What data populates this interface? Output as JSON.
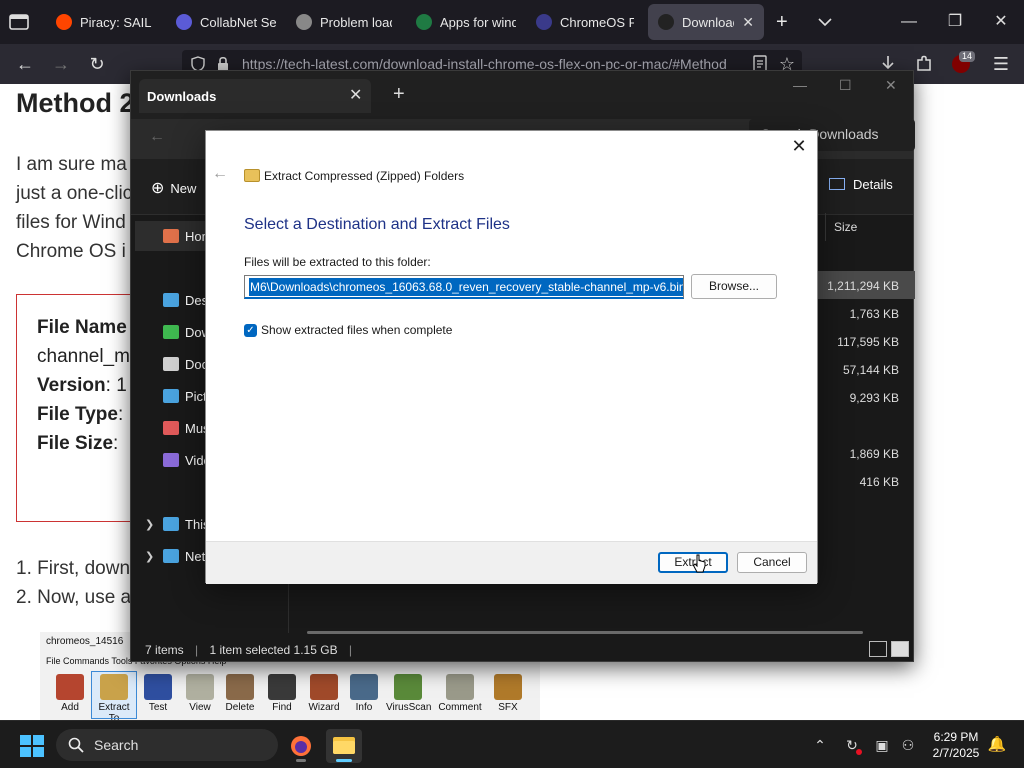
{
  "browser": {
    "tabs": [
      {
        "label": "Piracy: SAIL THE",
        "icon": "reddit-icon",
        "color": "#ff4500"
      },
      {
        "label": "CollabNet Sea",
        "icon": "search-icon",
        "color": "#5b5bd6"
      },
      {
        "label": "Problem loadi",
        "icon": "info-icon",
        "color": "#888888"
      },
      {
        "label": "Apps for winde",
        "icon": "excel-icon",
        "color": "#1f7a43"
      },
      {
        "label": "ChromeOS Fle",
        "icon": "chromeos-icon",
        "color": "#3a3a8a"
      },
      {
        "label": "Download a",
        "icon": "techlatest-icon",
        "color": "#222222"
      }
    ],
    "active_tab_index": 5,
    "url": "https://tech-latest.com/download-install-chrome-os-flex-on-pc-or-mac/#Method",
    "extension_badge": "14"
  },
  "article": {
    "heading": "Method 2",
    "paragraph": [
      "I am sure ma",
      "just a one-clic",
      "files for Wind",
      "Chrome OS i"
    ],
    "info": [
      {
        "key": "File Name",
        "value": ""
      },
      {
        "key": "",
        "value": "channel_m"
      },
      {
        "key": "Version",
        "value": ": 1"
      },
      {
        "key": "File Type",
        "value": ":"
      },
      {
        "key": "File Size",
        "value": ":"
      }
    ],
    "steps": [
      "1. First, down",
      "2. Now, use a"
    ]
  },
  "winrar": {
    "title": "chromeos_14516",
    "menu": "File   Commands   Tools   Favorites   Options   Help",
    "tools": [
      {
        "label": "Add",
        "icon": "add-archive-icon",
        "color": "#b5452f"
      },
      {
        "label": "Extract To",
        "icon": "extract-to-icon",
        "color": "#c9a24a",
        "selected": true
      },
      {
        "label": "Test",
        "icon": "test-icon",
        "color": "#2f4fa0"
      },
      {
        "label": "View",
        "icon": "view-icon",
        "color": "#b0b0a0"
      },
      {
        "label": "Delete",
        "icon": "delete-icon",
        "color": "#8a6a4a"
      },
      {
        "label": "Find",
        "icon": "find-icon",
        "color": "#3a3a3a"
      },
      {
        "label": "Wizard",
        "icon": "wizard-icon",
        "color": "#a04a2a"
      },
      {
        "label": "Info",
        "icon": "info-icon",
        "color": "#4a6a8a"
      },
      {
        "label": "VirusScan",
        "icon": "virusscan-icon",
        "color": "#5a8a3a"
      },
      {
        "label": "Comment",
        "icon": "comment-icon",
        "color": "#9a9a8a"
      },
      {
        "label": "SFX",
        "icon": "sfx-icon",
        "color": "#b07a2a"
      }
    ]
  },
  "explorer": {
    "tab_title": "Downloads",
    "search_placeholder": "Search Downloads",
    "new_label": "New",
    "details_label": "Details",
    "size_header": "Size",
    "nav": [
      {
        "label": "Home",
        "icon": "home-icon",
        "color": "#e0714a"
      },
      {
        "label": "Desk",
        "icon": "desktop-icon",
        "color": "#4aa3df"
      },
      {
        "label": "Dow",
        "icon": "downloads-icon",
        "color": "#3fb950"
      },
      {
        "label": "Doc",
        "icon": "documents-icon",
        "color": "#d0d0d0"
      },
      {
        "label": "Pict",
        "icon": "pictures-icon",
        "color": "#4aa3df"
      },
      {
        "label": "Mus",
        "icon": "music-icon",
        "color": "#e05a5a"
      },
      {
        "label": "Vide",
        "icon": "videos-icon",
        "color": "#8a6ad8"
      },
      {
        "label": "This",
        "icon": "this-pc-icon",
        "color": "#4aa3df"
      },
      {
        "label": "Netw",
        "icon": "network-icon",
        "color": "#4aa3df"
      }
    ],
    "sizes": [
      "1,211,294 KB",
      "1,763 KB",
      "117,595 KB",
      "57,144 KB",
      "9,293 KB",
      "",
      "1,869 KB",
      "416 KB"
    ],
    "status": {
      "items": "7 items",
      "selected": "1 item selected  1.15 GB"
    }
  },
  "dialog": {
    "crumb": "Extract Compressed (Zipped) Folders",
    "heading": "Select a Destination and Extract Files",
    "path_label": "Files will be extracted to this folder:",
    "path_value": "M6\\Downloads\\chromeos_16063.68.0_reven_recovery_stable-channel_mp-v6.bin",
    "browse_label": "Browse...",
    "checkbox_label": "Show extracted files when complete",
    "checkbox_checked": true,
    "extract_label": "Extract",
    "cancel_label": "Cancel"
  },
  "taskbar": {
    "search_label": "Search",
    "time": "6:29 PM",
    "date": "2/7/2025"
  }
}
